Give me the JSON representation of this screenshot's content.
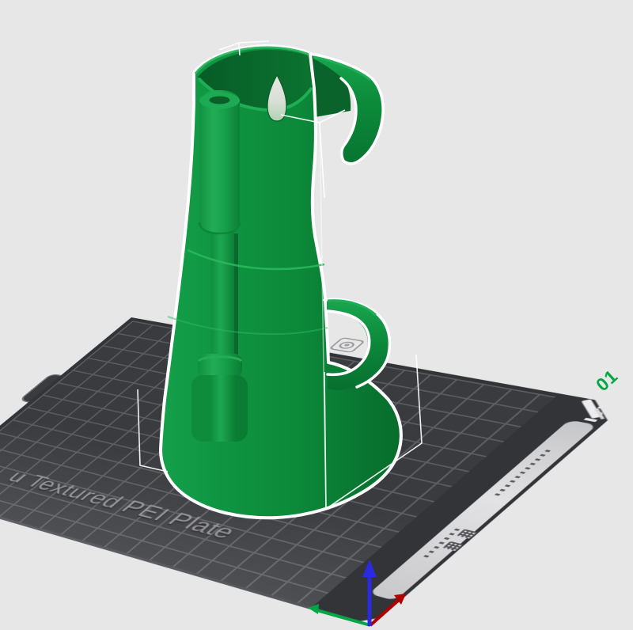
{
  "scene": {
    "type": "3d-slicer-viewport",
    "background_color": "#e7e7e8"
  },
  "build_plate": {
    "label": "u Textured PEI Plate",
    "plate_number": "01",
    "plate_number_color": "#00a843",
    "surface_color": "#3a3b3f",
    "grid_line_color": "#5d5d63",
    "label_color": "#97979b",
    "edge_band_color": "#d6d6d9",
    "marker_icons": [
      "wipe-zone-icon",
      "calibration-target-icon",
      "io-marker-icon",
      "qr-icon",
      "plate-handle-tab"
    ]
  },
  "model": {
    "description": "green cylindrical holder with C-clips, selected",
    "body_color": "#0d8f3e",
    "outline_color": "#ffffff",
    "selected": true
  },
  "axes_indicator": {
    "x_color": "#b00000",
    "y_color": "#00a843",
    "z_color": "#2a2ae0"
  }
}
